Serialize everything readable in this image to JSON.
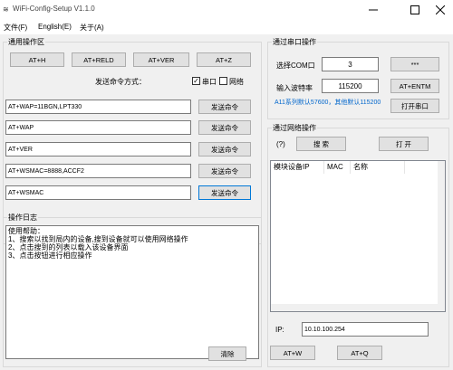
{
  "window": {
    "title": "WiFi-Config-Setup V1.1.0",
    "icon": "wifi-config-app-icon"
  },
  "menu": [
    "文件(F)",
    "English(E)",
    "关于(A)"
  ],
  "common_ops": {
    "title": "通用操作区",
    "buttons": [
      "AT+H",
      "AT+RELD",
      "AT+VER",
      "AT+Z"
    ],
    "send_mode_label": "发送命令方式：",
    "serial_label": "串口",
    "serial_checked": true,
    "network_label": "网络",
    "network_checked": false,
    "commands": [
      "AT+WAP=11BGN,LPT330",
      "AT+WAP",
      "AT+VER",
      "AT+WSMAC=8888,ACCF2",
      "AT+WSMAC"
    ],
    "send_label": "发送命令"
  },
  "log": {
    "title": "操作日志",
    "lines": [
      "使用帮助：",
      "1、搜索以找到局内的设备,搜到设备就可以使用网络操作",
      "2、点击搜到的列表以载入该设备界面",
      "3、点击按钮进行相应操作"
    ],
    "clear_label": "清除"
  },
  "serial": {
    "title": "通过串口操作",
    "com_label": "选择COM口",
    "com_value": "3",
    "more_label": "***",
    "baud_label": "输入波特率",
    "baud_value": "115200",
    "entm_label": "AT+ENTM",
    "note": "A11系列默认57600，其他默认115200",
    "open_label": "打开串口"
  },
  "network": {
    "title": "通过网络操作",
    "help": "(?)",
    "search_label": "搜  索",
    "open_label": "打 开",
    "columns": [
      "模块设备IP",
      "MAC",
      "名称"
    ],
    "ip_label": "IP:",
    "ip_value": "10.10.100.254",
    "btn_w": "AT+W",
    "btn_q": "AT+Q"
  }
}
